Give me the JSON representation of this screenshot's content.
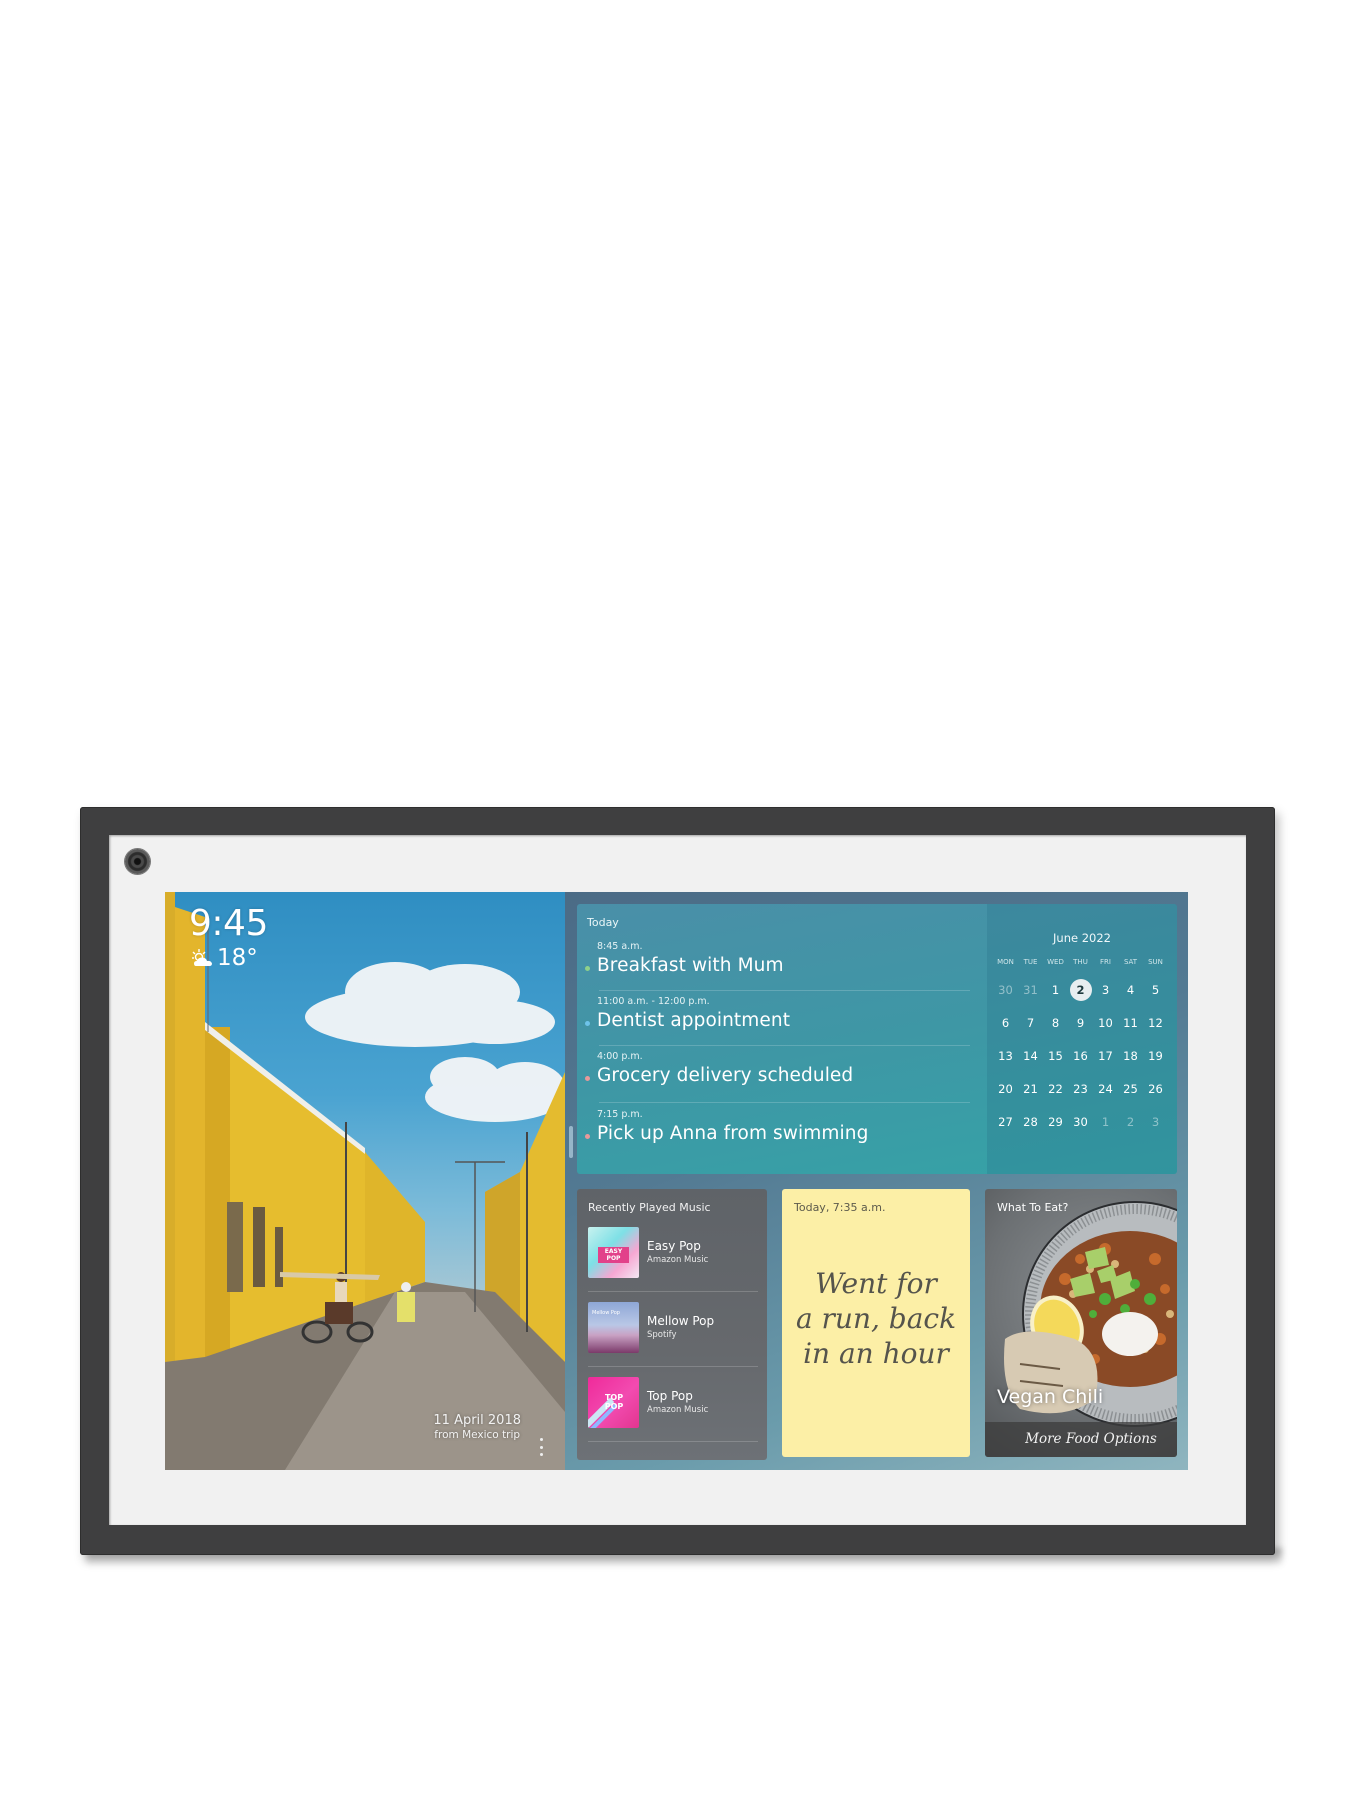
{
  "device": {
    "camera": "front-camera"
  },
  "photo": {
    "clock": "9:45",
    "weather": {
      "icon": "partly-cloudy-icon",
      "temperature": "18°"
    },
    "caption_date": "11 April 2018",
    "caption_source": "from Mexico trip",
    "more_icon": "more-vertical-icon"
  },
  "agenda": {
    "title": "Today",
    "events": [
      {
        "time": "8:45 a.m.",
        "title": "Breakfast with Mum",
        "dot_color": "#8fd18a"
      },
      {
        "time": "11:00 a.m. - 12:00 p.m.",
        "title": "Dentist appointment",
        "dot_color": "#6ec3ea"
      },
      {
        "time": "4:00 p.m.",
        "title": "Grocery delivery scheduled",
        "dot_color": "#e8999a"
      },
      {
        "time": "7:15 p.m.",
        "title": "Pick up Anna from swimming",
        "dot_color": "#e8999a"
      }
    ]
  },
  "calendar": {
    "title": "June 2022",
    "weekdays": [
      "MON",
      "TUE",
      "WED",
      "THU",
      "FRI",
      "SAT",
      "SUN"
    ],
    "weeks": [
      [
        "30",
        "31",
        "1",
        "2",
        "3",
        "4",
        "5"
      ],
      [
        "6",
        "7",
        "8",
        "9",
        "10",
        "11",
        "12"
      ],
      [
        "13",
        "14",
        "15",
        "16",
        "17",
        "18",
        "19"
      ],
      [
        "20",
        "21",
        "22",
        "23",
        "24",
        "25",
        "26"
      ],
      [
        "27",
        "28",
        "29",
        "30",
        "1",
        "2",
        "3"
      ]
    ],
    "muted_cells": [
      "0-0",
      "0-1",
      "4-4",
      "4-5",
      "4-6"
    ],
    "today_cell": "0-3"
  },
  "music": {
    "title": "Recently Played Music",
    "items": [
      {
        "name": "Easy Pop",
        "source": "Amazon Music",
        "art_label": "EASY POP"
      },
      {
        "name": "Mellow Pop",
        "source": "Spotify",
        "art_label": "Mellow Pop"
      },
      {
        "name": "Top Pop",
        "source": "Amazon Music",
        "art_label": "TOP POP"
      }
    ]
  },
  "note": {
    "time": "Today, 7:35 a.m.",
    "lines": [
      "Went for",
      "a run, back",
      "in an hour"
    ]
  },
  "food": {
    "title": "What To Eat?",
    "dish": "Vegan Chili",
    "more_label": "More Food Options"
  }
}
